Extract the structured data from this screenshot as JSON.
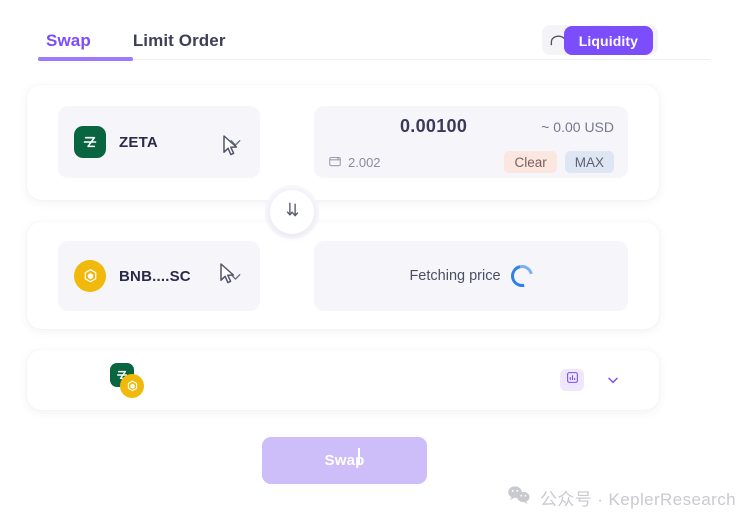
{
  "tabs": [
    {
      "label": "Swap",
      "active": true
    },
    {
      "label": "Limit Order",
      "active": false
    }
  ],
  "toolbar": {
    "bridge_icon": "bridge-icon",
    "settings_icon": "gear-icon",
    "chart_add_icon": "chart-add-icon",
    "liquidity_label": "Liquidity"
  },
  "from": {
    "token_symbol": "ZETA",
    "token_logo": "zeta-logo",
    "amount": "0.00100",
    "usd_value": "~ 0.00 USD",
    "balance_icon": "wallet-icon",
    "balance": "2.002",
    "clear_label": "Clear",
    "max_label": "MAX"
  },
  "swap_direction": {
    "icon": "double-down-arrow-icon"
  },
  "to": {
    "token_symbol": "BNB....SC",
    "token_logo": "bnb-logo",
    "status_text": "Fetching price",
    "spinner": "loading-spinner"
  },
  "route": {
    "logo_from": "zeta-logo",
    "logo_to": "bnb-logo",
    "chart_icon": "chart-icon",
    "expand_icon": "chevron-down-icon"
  },
  "submit": {
    "label": "Swap"
  },
  "watermark": {
    "icon": "wechat-icon",
    "text": "公众号 · KeplerResearch"
  },
  "colors": {
    "accent_purple": "#7b4dfb",
    "accent_purple_light": "#cdbdf9",
    "zeta_green": "#09653f",
    "bnb_yellow": "#f0b90b",
    "spinner_blue": "#2f80ed",
    "clear_bg": "#fbe6e0",
    "max_bg": "#dfe6f3"
  }
}
